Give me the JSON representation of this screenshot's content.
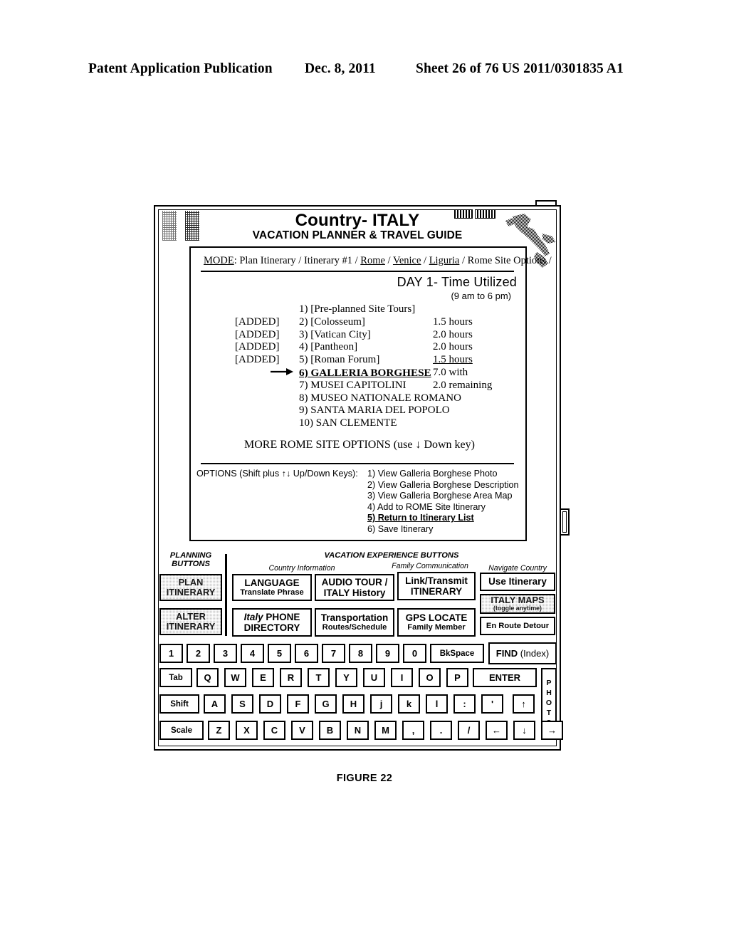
{
  "patent_header": {
    "publication": "Patent Application Publication",
    "date": "Dec. 8, 2011",
    "sheet": "Sheet 26 of 76",
    "number": "US 2011/0301835 A1"
  },
  "figure_caption": "FIGURE 22",
  "device": {
    "title": "Country- ITALY",
    "subtitle": "VACATION PLANNER & TRAVEL GUIDE"
  },
  "screen": {
    "mode_prefix": "MODE",
    "mode_line": ": Plan Itinerary / Itinerary #1 / Rome / Venice / Liguria / Rome Site Options /",
    "mode_parts": {
      "p1": ": Plan Itinerary / Itinerary #1 / ",
      "rome": "Rome",
      "sep1": " / ",
      "venice": "Venice",
      "sep2": " / ",
      "liguria": "Liguria",
      "tail": " / Rome Site Options /"
    },
    "day_title": "DAY 1- Time Utilized",
    "day_sub": "(9 am to 6 pm)",
    "site_list": [
      {
        "added": "",
        "name": "1) [Pre-planned Site Tours]",
        "time": "",
        "selected": false,
        "time_underline": false
      },
      {
        "added": "[ADDED]",
        "name": "2) [Colosseum]",
        "time": "1.5 hours",
        "selected": false,
        "time_underline": false
      },
      {
        "added": "[ADDED]",
        "name": "3) [Vatican City]",
        "time": "2.0 hours",
        "selected": false,
        "time_underline": false
      },
      {
        "added": "[ADDED]",
        "name": "4) [Pantheon]",
        "time": "2.0 hours",
        "selected": false,
        "time_underline": false
      },
      {
        "added": "[ADDED]",
        "name": "5) [Roman Forum]",
        "time": "1.5 hours",
        "selected": false,
        "time_underline": true
      },
      {
        "added": "",
        "name": "6) GALLERIA BORGHESE",
        "time": "7.0 with",
        "selected": true,
        "time_underline": false
      },
      {
        "added": "",
        "name": "7) MUSEI CAPITOLINI",
        "time": "2.0 remaining",
        "selected": false,
        "time_underline": false
      },
      {
        "added": "",
        "name": "8) MUSEO NATIONALE ROMANO",
        "time": "",
        "selected": false,
        "time_underline": false
      },
      {
        "added": "",
        "name": "9) SANTA MARIA DEL POPOLO",
        "time": "",
        "selected": false,
        "time_underline": false
      },
      {
        "added": "",
        "name": "10) SAN CLEMENTE",
        "time": "",
        "selected": false,
        "time_underline": false
      }
    ],
    "more_line": "MORE ROME SITE OPTIONS (use ↓ Down key)",
    "options_label": "OPTIONS (Shift plus ↑↓ Up/Down Keys):",
    "options": [
      {
        "text": "1) View Galleria Borghese Photo",
        "bold": false
      },
      {
        "text": "2) View Galleria Borghese Description",
        "bold": false
      },
      {
        "text": "3) View Galleria Borghese Area Map",
        "bold": false
      },
      {
        "text": "4) Add to ROME Site Itinerary",
        "bold": false
      },
      {
        "text": "5) Return to Itinerary List",
        "bold": true
      },
      {
        "text": "6) Save Itinerary",
        "bold": false
      }
    ]
  },
  "buttons": {
    "planning_heading_l1": "PLANNING",
    "planning_heading_l2": "BUTTONS",
    "vacation_heading": "VACATION EXPERIENCE BUTTONS",
    "cat_country_info": "Country Information",
    "cat_family_comm": "Family Communication",
    "cat_navigate": "Navigate Country",
    "plan_itinerary_l1": "PLAN",
    "plan_itinerary_l2": "ITINERARY",
    "alter_itinerary_l1": "ALTER",
    "alter_itinerary_l2": "ITINERARY",
    "language_l1": "LANGUAGE",
    "language_l2": "Translate Phrase",
    "audio_l1": "AUDIO TOUR /",
    "audio_l2": "ITALY History",
    "link_l1": "Link/Transmit",
    "link_l2": "ITINERARY",
    "use_itinerary": "Use Itinerary",
    "italy_maps_l1": "ITALY MAPS",
    "italy_maps_l2": "(toggle anytime)",
    "phone_l1a": "Italy",
    "phone_l1b": " PHONE",
    "phone_l2": "DIRECTORY",
    "transport_l1": "Transportation",
    "transport_l2": "Routes/Schedule",
    "gps_l1": "GPS LOCATE",
    "gps_l2": "Family Member",
    "detour": "En Route Detour",
    "find_l1": "FIND",
    "find_l2": " (Index)"
  },
  "keyboard": {
    "row_num": [
      "1",
      "2",
      "3",
      "4",
      "5",
      "6",
      "7",
      "8",
      "9",
      "0"
    ],
    "bkspace": "BkSpace",
    "row_q": [
      "Q",
      "W",
      "E",
      "R",
      "T",
      "Y",
      "U",
      "I",
      "O",
      "P"
    ],
    "tab": "Tab",
    "enter": "ENTER",
    "photo": [
      "P",
      "H",
      "O",
      "T",
      "O"
    ],
    "row_a": [
      "A",
      "S",
      "D",
      "F",
      "G",
      "H",
      "j",
      "k",
      "l",
      ":",
      "'"
    ],
    "shift": "Shift",
    "arrow_up": "↑",
    "row_z": [
      "Z",
      "X",
      "C",
      "V",
      "B",
      "N",
      "M",
      ",",
      ".",
      "/"
    ],
    "scale": "Scale",
    "arrow_left": "←",
    "arrow_down": "↓",
    "arrow_right": "→"
  }
}
